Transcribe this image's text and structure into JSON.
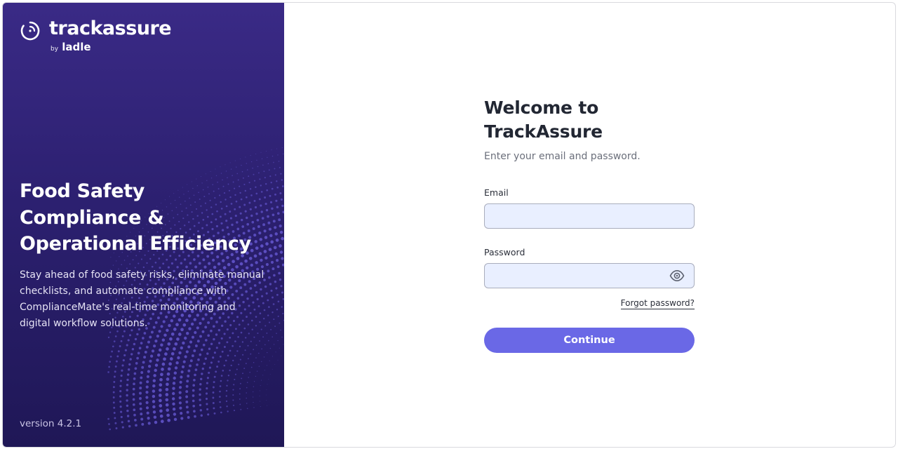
{
  "brand": {
    "name": "trackassure",
    "by": "by",
    "parent": "ladle",
    "logo_icon": "circle-gauge-icon"
  },
  "hero": {
    "title": "Food Safety Compliance & Operational Efficiency",
    "description": "Stay ahead of food safety risks, eliminate manual checklists, and automate compliance with ComplianceMate's real-time monitoring and digital workflow solutions.",
    "version": "version 4.2.1"
  },
  "form": {
    "title": "Welcome to TrackAssure",
    "subtitle": "Enter your email and password.",
    "email_label": "Email",
    "email_value": "",
    "password_label": "Password",
    "password_value": "",
    "password_toggle_icon": "eye-icon",
    "forgot_label": "Forgot password?",
    "submit_label": "Continue"
  },
  "colors": {
    "hero_bg": "#2c2070",
    "primary_button": "#6a68e6",
    "input_bg": "#e9efff"
  }
}
